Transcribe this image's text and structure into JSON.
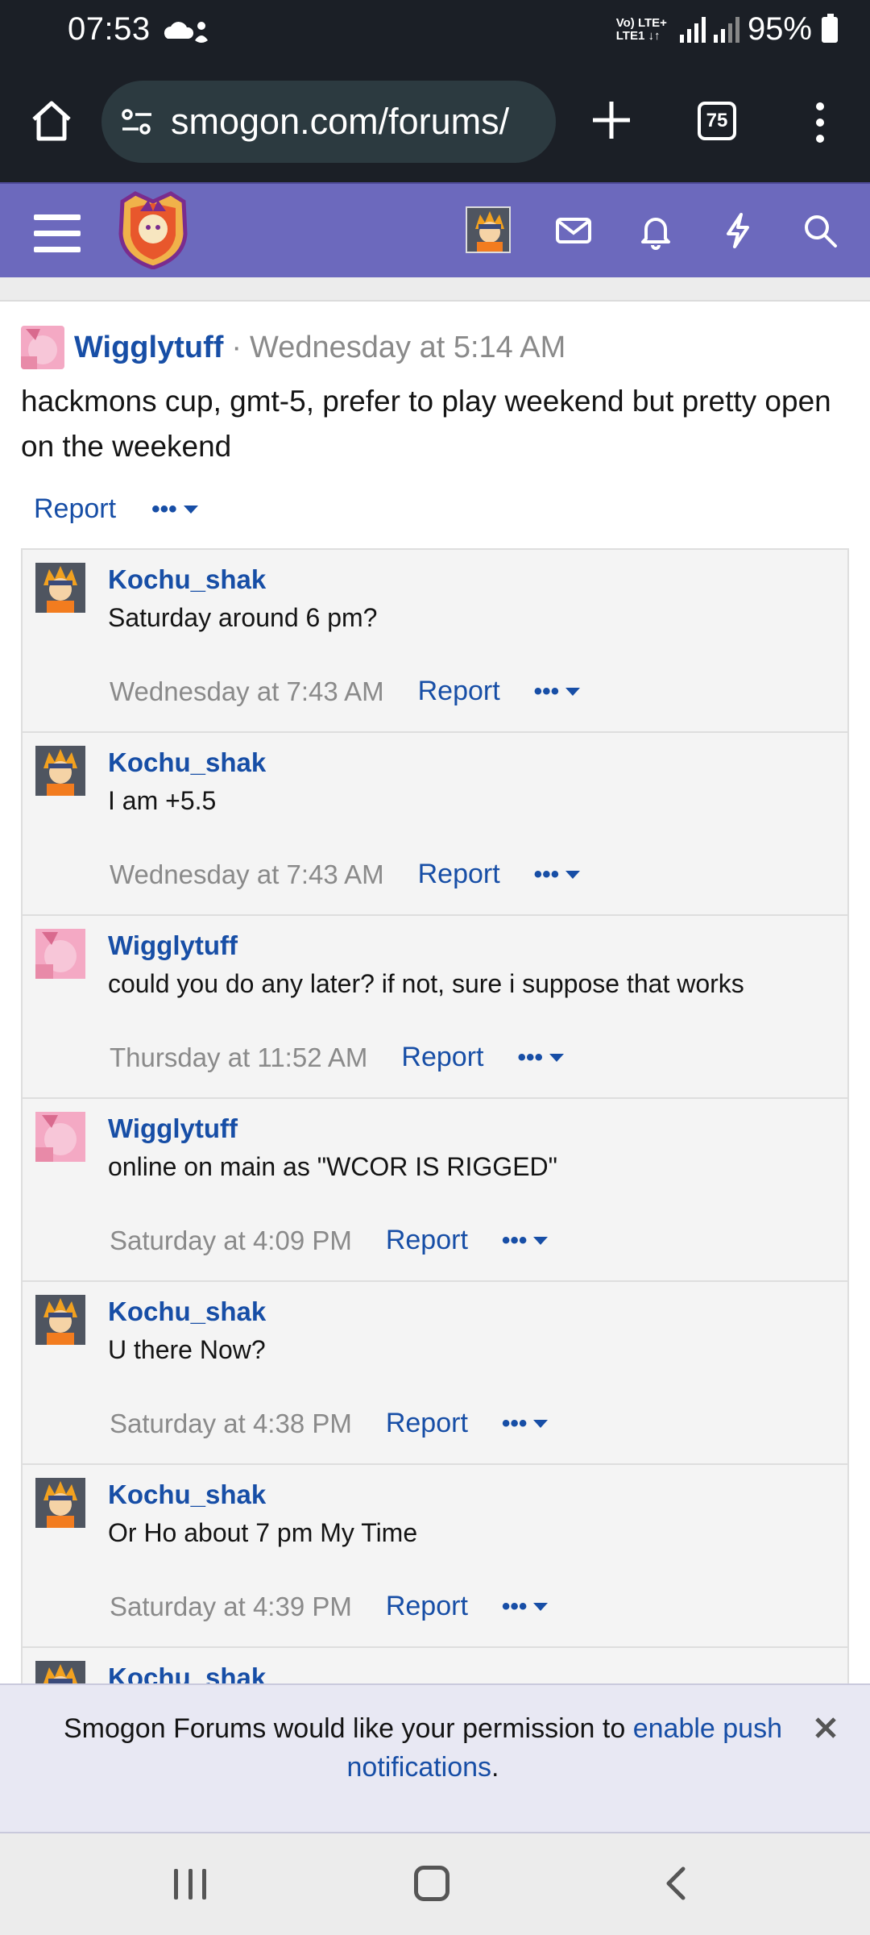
{
  "status_bar": {
    "time": "07:53",
    "net_label_top": "Vo) LTE+",
    "net_label_bottom": "LTE1 ↓↑",
    "battery": "95%"
  },
  "browser": {
    "url": "smogon.com/forums/",
    "tab_count": "75"
  },
  "post": {
    "author": "Wigglytuff",
    "separator": "·",
    "date": "Wednesday at 5:14 AM",
    "body": "hackmons cup, gmt-5, prefer to play weekend but pretty open on the weekend",
    "report_label": "Report",
    "more_label": "•••"
  },
  "comments": [
    {
      "author": "Kochu_shak",
      "avatar": "naruto",
      "text": "Saturday around 6 pm?",
      "date": "Wednesday at 7:43 AM",
      "report": "Report",
      "more": "•••"
    },
    {
      "author": "Kochu_shak",
      "avatar": "naruto",
      "text": "I am +5.5",
      "date": "Wednesday at 7:43 AM",
      "report": "Report",
      "more": "•••"
    },
    {
      "author": "Wigglytuff",
      "avatar": "pink",
      "text": "could you do any later? if not, sure i suppose that works",
      "date": "Thursday at 11:52 AM",
      "report": "Report",
      "more": "•••"
    },
    {
      "author": "Wigglytuff",
      "avatar": "pink",
      "text": "online on main as \"WCOR IS RIGGED\"",
      "date": "Saturday at 4:09 PM",
      "report": "Report",
      "more": "•••"
    },
    {
      "author": "Kochu_shak",
      "avatar": "naruto",
      "text": "U there Now?",
      "date": "Saturday at 4:38 PM",
      "report": "Report",
      "more": "•••"
    },
    {
      "author": "Kochu_shak",
      "avatar": "naruto",
      "text": "Or Ho about 7 pm My Time",
      "date": "Saturday at 4:39 PM",
      "report": "Report",
      "more": "•••"
    },
    {
      "author": "Kochu_shak",
      "avatar": "naruto",
      "text": "",
      "date": "",
      "report": "",
      "more": ""
    }
  ],
  "notification": {
    "text_before": "Smogon Forums would like your permission to ",
    "link_text": "enable push notifications",
    "text_after": "."
  },
  "colors": {
    "header_purple": "#6c69bd",
    "link_blue": "#174ea6",
    "browser_dark": "#1b1f26"
  }
}
